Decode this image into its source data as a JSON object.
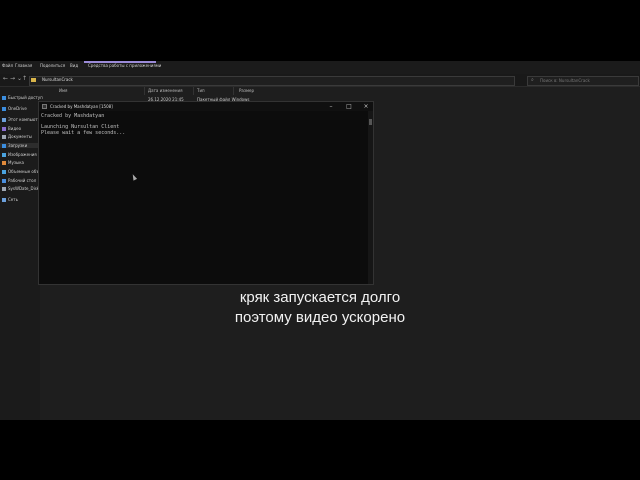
{
  "ribbon": {
    "tabs": [
      "Файл",
      "Главная",
      "Поделиться",
      "Вид",
      "Средства работы с приложениями"
    ]
  },
  "address": {
    "path": "NursultanCrack",
    "search_placeholder": "Поиск в: NursultanCrack"
  },
  "sidebar": {
    "items": [
      {
        "label": "Быстрый доступ",
        "icon": "star-icon",
        "color": "#3b8ee0"
      },
      {
        "label": "OneDrive",
        "icon": "cloud-icon",
        "color": "#3b8ee0"
      },
      {
        "label": "Этот компьютер",
        "icon": "computer-icon",
        "color": "#6ca0dc"
      },
      {
        "label": "Видео",
        "icon": "video-icon",
        "color": "#8a6fd1"
      },
      {
        "label": "Документы",
        "icon": "document-icon",
        "color": "#9fa7b3"
      },
      {
        "label": "Загрузки",
        "icon": "download-icon",
        "color": "#3b8ee0"
      },
      {
        "label": "Изображения",
        "icon": "image-icon",
        "color": "#4aa3df"
      },
      {
        "label": "Музыка",
        "icon": "music-icon",
        "color": "#e08a3b"
      },
      {
        "label": "Объемные объ",
        "icon": "cube-icon",
        "color": "#4aa3df"
      },
      {
        "label": "Рабочий стол",
        "icon": "desktop-icon",
        "color": "#4a8fdf"
      },
      {
        "label": "SysWDate_Disk (",
        "icon": "drive-icon",
        "color": "#9fa7b3"
      },
      {
        "label": "Сеть",
        "icon": "network-icon",
        "color": "#6ca0dc"
      }
    ]
  },
  "columns": {
    "name": "Имя",
    "date": "Дата изменения",
    "type": "Тип",
    "size": "Размер"
  },
  "file_row": {
    "name": "",
    "date": "26.12.2020 21:45",
    "type": "Пакетный файл Windows"
  },
  "console": {
    "title": "Cracked by Mashdatyan [1508]",
    "lines": [
      "Cracked by Mashdatyan",
      "",
      "Launching Nursultan Client",
      "Please wait a few seconds..."
    ]
  },
  "caption": {
    "line1": "кряк запускается долго",
    "line2": "поэтому видео ускорено"
  }
}
